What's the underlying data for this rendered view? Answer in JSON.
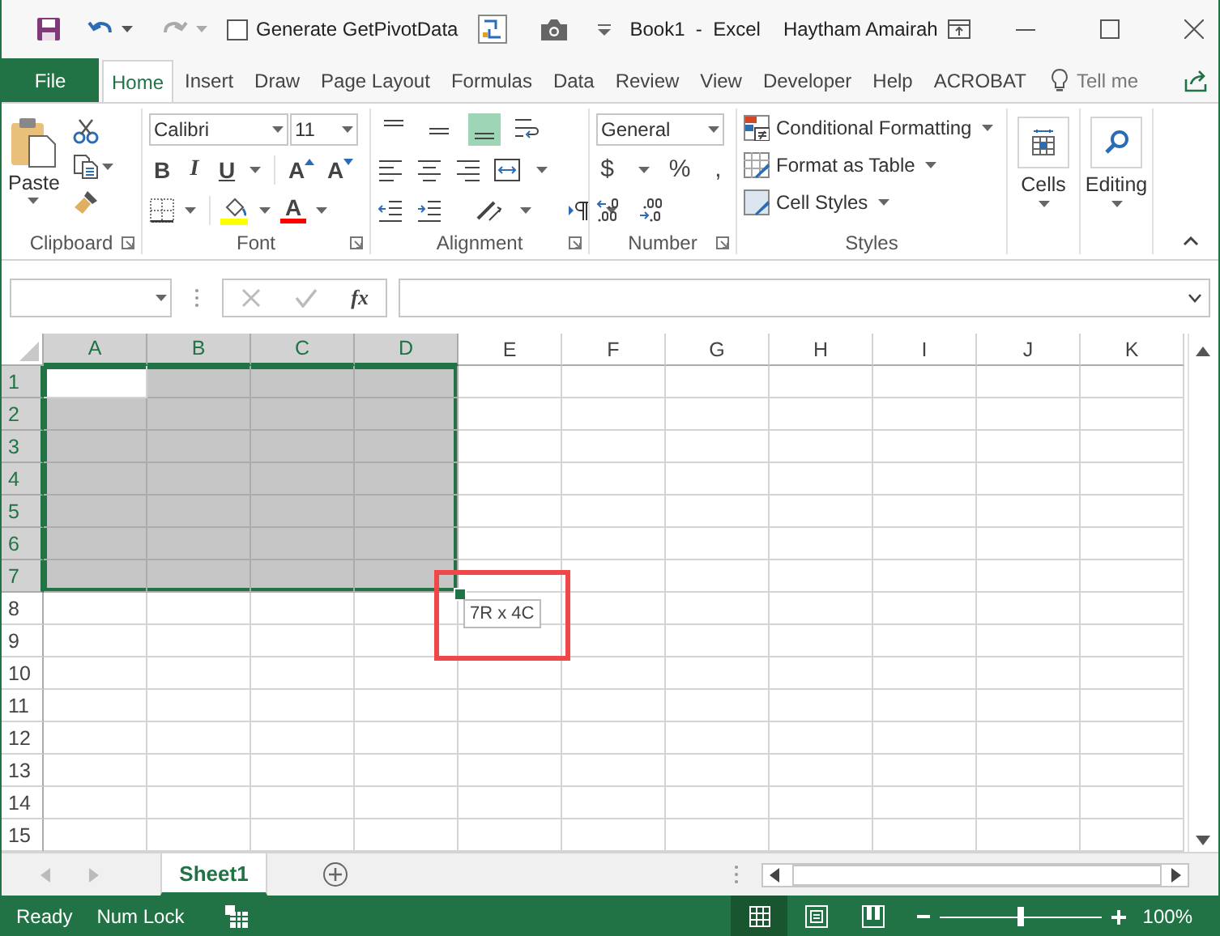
{
  "title_bar": {
    "checkbox": {
      "label": "Generate GetPivotData",
      "checked": false
    },
    "title": "Book1  -  Excel",
    "user": "Haytham Amairah"
  },
  "tabs": [
    {
      "label": "File",
      "kind": "file",
      "selected": false
    },
    {
      "label": "Home",
      "kind": "tab",
      "selected": true
    },
    {
      "label": "Insert",
      "kind": "tab",
      "selected": false
    },
    {
      "label": "Draw",
      "kind": "tab",
      "selected": false
    },
    {
      "label": "Page Layout",
      "kind": "tab",
      "selected": false
    },
    {
      "label": "Formulas",
      "kind": "tab",
      "selected": false
    },
    {
      "label": "Data",
      "kind": "tab",
      "selected": false
    },
    {
      "label": "Review",
      "kind": "tab",
      "selected": false
    },
    {
      "label": "View",
      "kind": "tab",
      "selected": false
    },
    {
      "label": "Developer",
      "kind": "tab",
      "selected": false
    },
    {
      "label": "Help",
      "kind": "tab",
      "selected": false
    },
    {
      "label": "ACROBAT",
      "kind": "tab",
      "selected": false
    }
  ],
  "tell_me": {
    "placeholder": "Tell me"
  },
  "ribbon": {
    "groups": [
      {
        "kind": "clipboard",
        "label": "Clipboard",
        "launcher": true,
        "paste": "Paste"
      },
      {
        "kind": "font",
        "label": "Font",
        "launcher": true,
        "font_name": "Calibri",
        "font_size": "11",
        "style_buttons": [
          "B",
          "I",
          "U"
        ],
        "size_buttons": [
          "A",
          "A"
        ],
        "color_button": "A"
      },
      {
        "kind": "alignment",
        "label": "Alignment",
        "launcher": true,
        "vertical_align": [
          {
            "selected": false
          },
          {
            "selected": false
          },
          {
            "selected": true
          }
        ]
      },
      {
        "kind": "number",
        "label": "Number",
        "launcher": true,
        "format": "General",
        "symbols": [
          "$",
          "%",
          ","
        ]
      },
      {
        "kind": "styles",
        "label": "Styles",
        "launcher": false,
        "buttons": [
          "Conditional Formatting",
          "Format as Table",
          "Cell Styles"
        ]
      },
      {
        "kind": "big",
        "button": "Cells"
      },
      {
        "kind": "big",
        "button": "Editing"
      }
    ]
  },
  "formula_bar": {
    "function_label": "fx"
  },
  "grid": {
    "columns": [
      {
        "label": "A",
        "selected": true
      },
      {
        "label": "B",
        "selected": true
      },
      {
        "label": "C",
        "selected": true
      },
      {
        "label": "D",
        "selected": true
      },
      {
        "label": "E",
        "selected": false
      },
      {
        "label": "F",
        "selected": false
      },
      {
        "label": "G",
        "selected": false
      },
      {
        "label": "H",
        "selected": false
      },
      {
        "label": "I",
        "selected": false
      },
      {
        "label": "J",
        "selected": false
      },
      {
        "label": "K",
        "selected": false
      }
    ],
    "rows": [
      {
        "label": "1",
        "selected": true
      },
      {
        "label": "2",
        "selected": true
      },
      {
        "label": "3",
        "selected": true
      },
      {
        "label": "4",
        "selected": true
      },
      {
        "label": "5",
        "selected": true
      },
      {
        "label": "6",
        "selected": true
      },
      {
        "label": "7",
        "selected": true
      },
      {
        "label": "8",
        "selected": false
      },
      {
        "label": "9",
        "selected": false
      },
      {
        "label": "10",
        "selected": false
      },
      {
        "label": "11",
        "selected": false
      },
      {
        "label": "12",
        "selected": false
      },
      {
        "label": "13",
        "selected": false
      },
      {
        "label": "14",
        "selected": false
      },
      {
        "label": "15",
        "selected": false
      }
    ],
    "size_tip": "7R x 4C"
  },
  "sheet_tabs": [
    {
      "label": "Sheet1",
      "selected": true
    }
  ],
  "status_bar": {
    "items": [
      "Ready",
      "Num Lock"
    ],
    "views": [
      {
        "selected": true
      },
      {
        "selected": false
      },
      {
        "selected": false
      }
    ],
    "zoom": {
      "level": 0.5,
      "reading": "100%"
    }
  }
}
